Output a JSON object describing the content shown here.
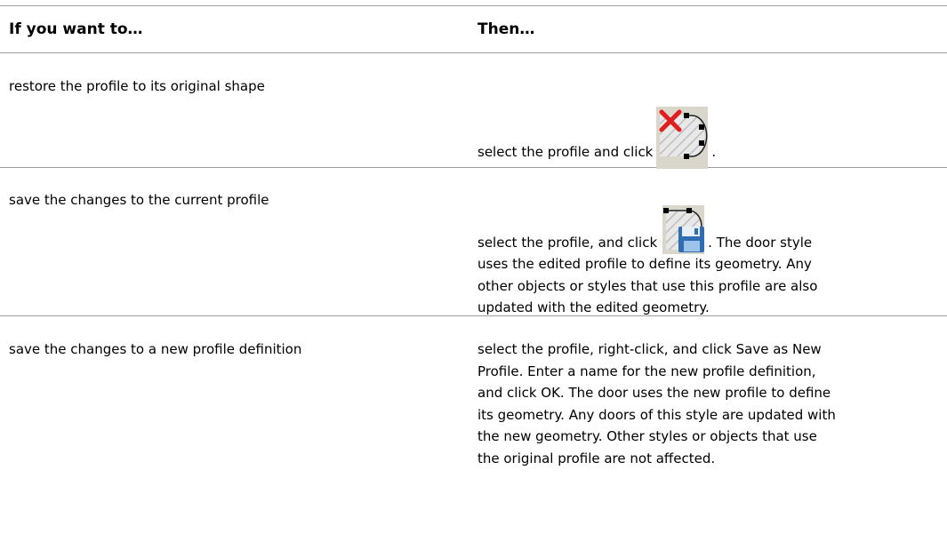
{
  "table": {
    "headers": {
      "col1": "If you want to…",
      "col2": "Then…"
    },
    "rows": [
      {
        "action": "restore the profile to its original shape",
        "result_before_icon": "select the profile and click",
        "icon": "restore-profile-icon",
        "result_after_icon": "."
      },
      {
        "action": "save the changes to the current profile",
        "result_before_icon": "select the profile, and click",
        "icon": "save-profile-icon",
        "result_after_icon_line1": ". The door style",
        "result_line2": "uses the edited profile to define its geometry. Any",
        "result_line3": "other objects or styles that use this profile are also",
        "result_line4": "updated with the edited geometry."
      },
      {
        "action": "save the changes to a new profile definition",
        "result_lines": [
          "select the profile, right-click, and click Save as New",
          "Profile. Enter a name for the new profile definition,",
          "and click OK. The door uses the new profile to define",
          "its geometry. Any doors of this style are updated with",
          "the new geometry. Other styles or objects that use",
          "the original profile are not affected."
        ]
      }
    ]
  }
}
